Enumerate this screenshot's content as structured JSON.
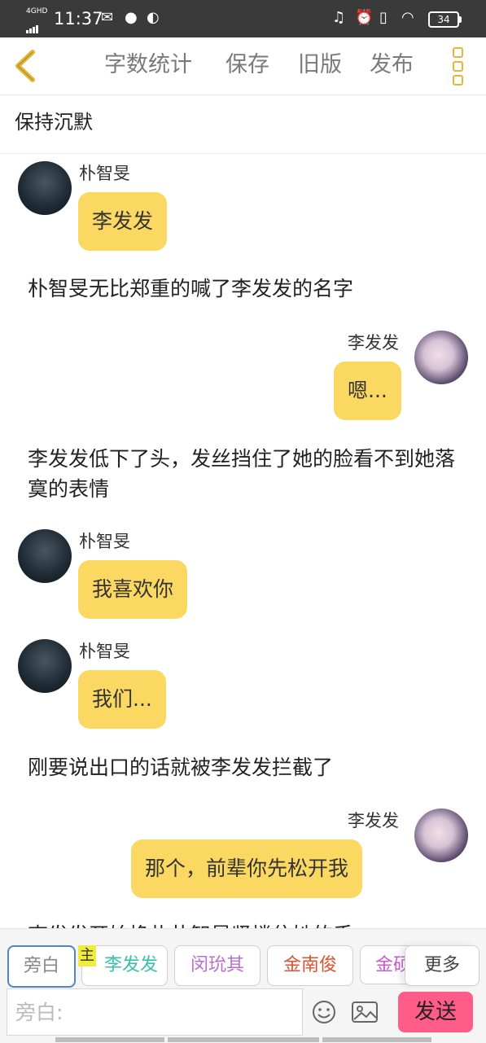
{
  "status": {
    "network": "4GHD",
    "time": "11:37",
    "battery": "34"
  },
  "toolbar": {
    "word_count": "字数统计",
    "save": "保存",
    "old_version": "旧版",
    "publish": "发布"
  },
  "title": "保持沉默",
  "messages": [
    {
      "name": "朴智旻",
      "text": "李发发"
    },
    {
      "narration": "朴智旻无比郑重的喊了李发发的名字"
    },
    {
      "name": "李发发",
      "text": "嗯..."
    },
    {
      "narration": "李发发低下了头，发丝挡住了她的脸看不到她落寞的表情"
    },
    {
      "name": "朴智旻",
      "text": "我喜欢你"
    },
    {
      "name": "朴智旻",
      "text": "我们..."
    },
    {
      "narration": "刚要说出口的话就被李发发拦截了"
    },
    {
      "name": "李发发",
      "text": "那个，前辈你先松开我"
    },
    {
      "narration": "李发发开始挣扎朴智旻紧搂住她的手"
    }
  ],
  "roles": [
    {
      "label": "旁白",
      "color": "#888888"
    },
    {
      "label": "李发发",
      "color": "#3bbfb0",
      "badge": "主"
    },
    {
      "label": "闵玧其",
      "color": "#b96fd1"
    },
    {
      "label": "金南俊",
      "color": "#d9532f"
    },
    {
      "label": "金硕",
      "color": "#c75bd0"
    }
  ],
  "more": "更多",
  "input_placeholder": "旁白:",
  "send": "发送",
  "colors": {
    "accent": "#fbd862",
    "send": "#ff5c8a",
    "icon": "#e2b63a"
  }
}
